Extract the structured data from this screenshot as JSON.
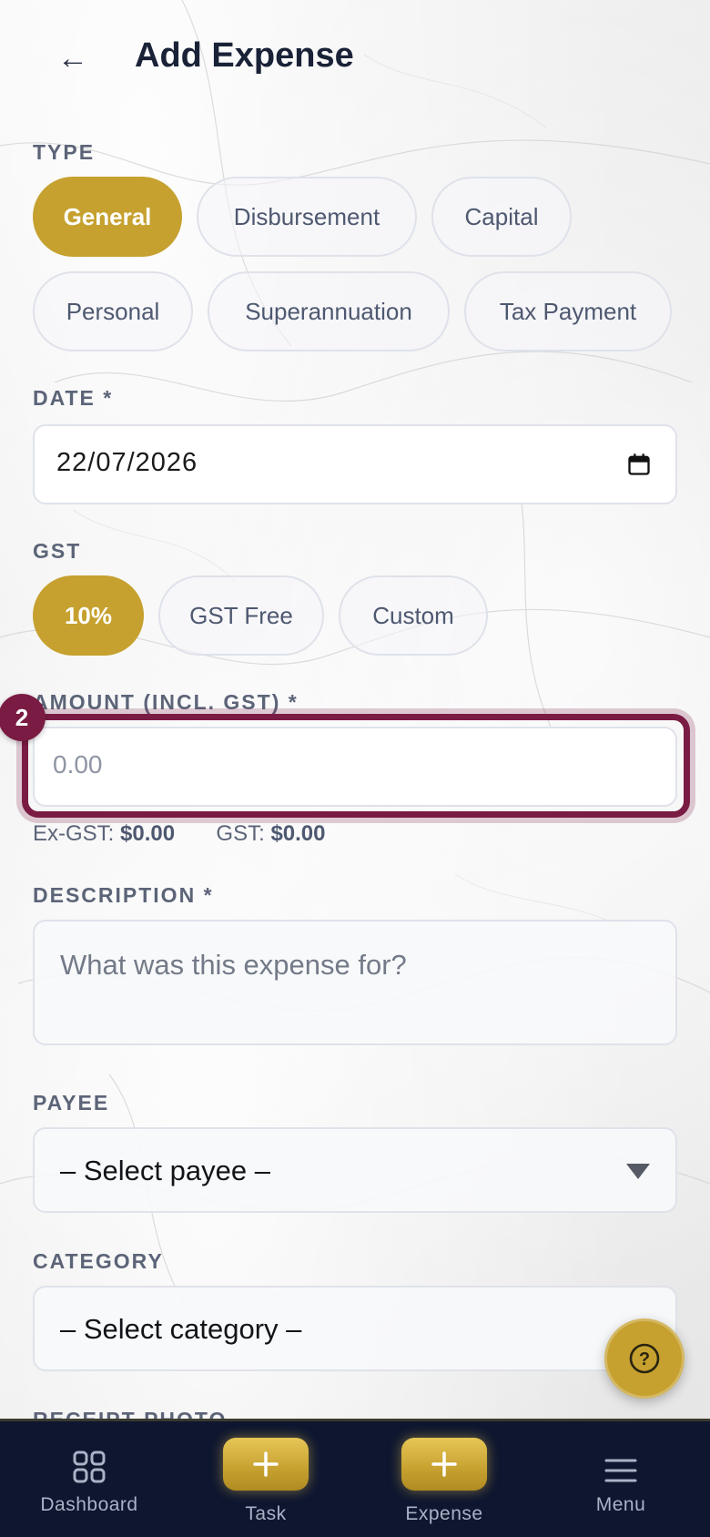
{
  "header": {
    "back_symbol": "←",
    "title": "Add Expense"
  },
  "type_section": {
    "label": "TYPE",
    "options": [
      "General",
      "Disbursement",
      "Capital",
      "Personal",
      "Superannuation",
      "Tax Payment"
    ],
    "selected": "General"
  },
  "date_section": {
    "label": "DATE *",
    "value": "22/07/2026"
  },
  "gst_section": {
    "label": "GST",
    "options": [
      "10%",
      "GST Free",
      "Custom"
    ],
    "selected": "10%"
  },
  "amount_section": {
    "label": "AMOUNT (INCL. GST) *",
    "placeholder": "0.00",
    "badge": "2",
    "ex_gst_label": "Ex-GST:",
    "ex_gst_value": "$0.00",
    "gst_label": "GST:",
    "gst_value": "$0.00"
  },
  "description_section": {
    "label": "DESCRIPTION *",
    "placeholder": "What was this expense for?"
  },
  "payee_section": {
    "label": "PAYEE",
    "selected": "– Select payee –"
  },
  "category_section": {
    "label": "CATEGORY",
    "selected": "– Select category –"
  },
  "receipt_section": {
    "label": "RECEIPT PHOTO"
  },
  "help_fab": {
    "symbol": "?"
  },
  "bottom_nav": {
    "items": [
      {
        "label": "Dashboard",
        "icon": "grid-icon"
      },
      {
        "label": "Task",
        "icon": "plus-icon"
      },
      {
        "label": "Expense",
        "icon": "plus-icon"
      },
      {
        "label": "Menu",
        "icon": "hamburger-icon"
      }
    ]
  },
  "colors": {
    "accent_gold": "#c6a12f",
    "highlight_maroon": "#7a1b43",
    "nav_bg": "#0e1630"
  }
}
